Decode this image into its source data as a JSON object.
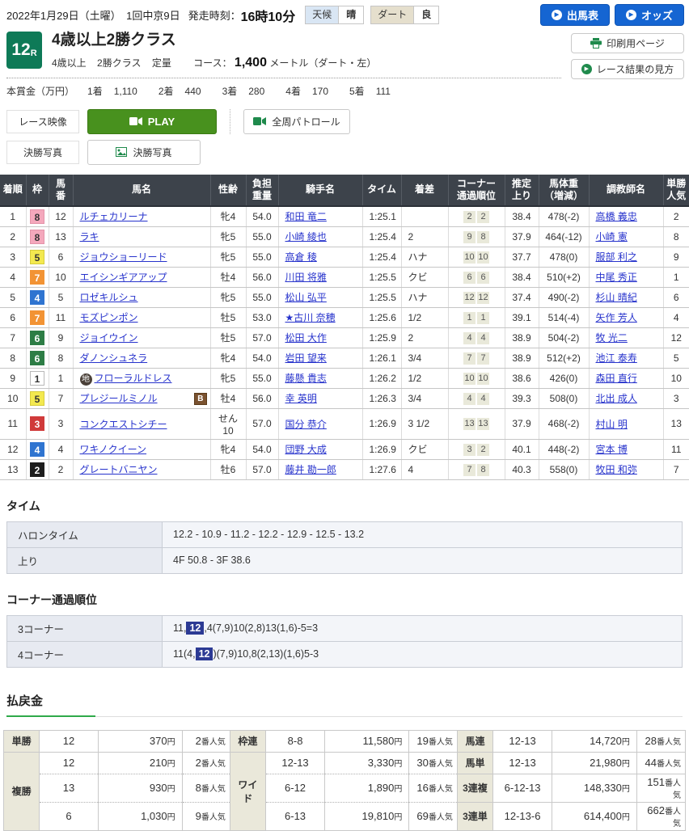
{
  "colors": {
    "link": "#2733cc",
    "table_header_bg": "#3d434b",
    "play_green": "#48911e",
    "blue_button": "#1565d2",
    "race_num_bg": "#0e7a57",
    "highlight_navy": "#2c3a94",
    "payout_accent_green": "#2faa4a",
    "weather_label_bg": "#d9e6f4",
    "track_label_bg": "#e5dfcd",
    "corner_box_bg": "#e9e9da"
  },
  "frame_colors": {
    "1": {
      "bg": "#ffffff",
      "fg": "#333333",
      "bd": "#b8b8b8"
    },
    "2": {
      "bg": "#1d1d1d",
      "fg": "#ffffff",
      "bd": "#1d1d1d"
    },
    "3": {
      "bg": "#d03a3a",
      "fg": "#ffffff",
      "bd": "#d03a3a"
    },
    "4": {
      "bg": "#2f74d0",
      "fg": "#ffffff",
      "bd": "#2f74d0"
    },
    "5": {
      "bg": "#f3e94f",
      "fg": "#333333",
      "bd": "#d6cc3c"
    },
    "6": {
      "bg": "#2d7d45",
      "fg": "#ffffff",
      "bd": "#2d7d45"
    },
    "7": {
      "bg": "#f29334",
      "fg": "#ffffff",
      "bd": "#f29334"
    },
    "8": {
      "bg": "#f4a8bc",
      "fg": "#333333",
      "bd": "#e493a9"
    }
  },
  "header": {
    "date_line": "2022年1月29日（土曜）　1回中京9日",
    "start_label": "発走時刻：",
    "start_time": "16時10分",
    "weather_label": "天候",
    "weather_value": "晴",
    "track_label": "ダート",
    "track_value": "良",
    "btn_entries": "出馬表",
    "btn_odds": "オッズ",
    "btn_print": "印刷用ページ",
    "btn_guide": "レース結果の見方"
  },
  "race": {
    "number": "12",
    "number_suffix": "R",
    "title": "4歳以上2勝クラス",
    "condition_age": "4歳以上",
    "condition_class": "2勝クラス",
    "condition_weight": "定量",
    "course_label": "コース：",
    "course_distance": "1,400",
    "course_unit": "メートル（ダート・左）",
    "prize_label": "本賞金（万円）",
    "prize_items": [
      {
        "place": "1着",
        "amount": "1,110"
      },
      {
        "place": "2着",
        "amount": "440"
      },
      {
        "place": "3着",
        "amount": "280"
      },
      {
        "place": "4着",
        "amount": "170"
      },
      {
        "place": "5着",
        "amount": "111"
      }
    ]
  },
  "media": {
    "video_label": "レース映像",
    "play_button": "PLAY",
    "patrol_button": "全周パトロール",
    "photo_label": "決勝写真",
    "photo_button": "決勝写真"
  },
  "results": {
    "headers": [
      [
        "着順"
      ],
      [
        "枠"
      ],
      [
        "馬",
        "番"
      ],
      [
        "馬名"
      ],
      [
        "性齢"
      ],
      [
        "負担",
        "重量"
      ],
      [
        "騎手名"
      ],
      [
        "タイム"
      ],
      [
        "着差"
      ],
      [
        "コーナー",
        "通過順位"
      ],
      [
        "推定",
        "上り"
      ],
      [
        "馬体重",
        "（増減）"
      ],
      [
        "調教師名"
      ],
      [
        "単勝",
        "人気"
      ]
    ],
    "rows": [
      {
        "pos": "1",
        "frame": "8",
        "num": "12",
        "mark": "",
        "horse": "ルチェカリーナ",
        "blinker": "",
        "sex_age": "牝4",
        "weight": "54.0",
        "jockey": "和田 竜二",
        "time": "1:25.1",
        "margin": "",
        "corners": [
          "2",
          "2"
        ],
        "last3f": "38.4",
        "horse_weight": "478(-2)",
        "trainer": "高橋 義忠",
        "fav": "2"
      },
      {
        "pos": "2",
        "frame": "8",
        "num": "13",
        "mark": "",
        "horse": "ラキ",
        "blinker": "",
        "sex_age": "牝5",
        "weight": "55.0",
        "jockey": "小崎 綾也",
        "time": "1:25.4",
        "margin": "2",
        "corners": [
          "9",
          "8"
        ],
        "last3f": "37.9",
        "horse_weight": "464(-12)",
        "trainer": "小崎 憲",
        "fav": "8"
      },
      {
        "pos": "3",
        "frame": "5",
        "num": "6",
        "mark": "",
        "horse": "ジョウショーリード",
        "blinker": "",
        "sex_age": "牝5",
        "weight": "55.0",
        "jockey": "高倉 稜",
        "time": "1:25.4",
        "margin": "ハナ",
        "corners": [
          "10",
          "10"
        ],
        "last3f": "37.7",
        "horse_weight": "478(0)",
        "trainer": "服部 利之",
        "fav": "9"
      },
      {
        "pos": "4",
        "frame": "7",
        "num": "10",
        "mark": "",
        "horse": "エイシンギアアップ",
        "blinker": "",
        "sex_age": "牡4",
        "weight": "56.0",
        "jockey": "川田 将雅",
        "time": "1:25.5",
        "margin": "クビ",
        "corners": [
          "6",
          "6"
        ],
        "last3f": "38.4",
        "horse_weight": "510(+2)",
        "trainer": "中尾 秀正",
        "fav": "1"
      },
      {
        "pos": "5",
        "frame": "4",
        "num": "5",
        "mark": "",
        "horse": "ロゼキルシュ",
        "blinker": "",
        "sex_age": "牝5",
        "weight": "55.0",
        "jockey": "松山 弘平",
        "time": "1:25.5",
        "margin": "ハナ",
        "corners": [
          "12",
          "12"
        ],
        "last3f": "37.4",
        "horse_weight": "490(-2)",
        "trainer": "杉山 晴紀",
        "fav": "6"
      },
      {
        "pos": "6",
        "frame": "7",
        "num": "11",
        "mark": "",
        "horse": "モズピンポン",
        "blinker": "",
        "sex_age": "牡5",
        "weight": "53.0",
        "jockey": "★古川 奈穂",
        "time": "1:25.6",
        "margin": "1/2",
        "corners": [
          "1",
          "1"
        ],
        "last3f": "39.1",
        "horse_weight": "514(-4)",
        "trainer": "矢作 芳人",
        "fav": "4"
      },
      {
        "pos": "7",
        "frame": "6",
        "num": "9",
        "mark": "",
        "horse": "ジョイウイン",
        "blinker": "",
        "sex_age": "牡5",
        "weight": "57.0",
        "jockey": "松田 大作",
        "time": "1:25.9",
        "margin": "2",
        "corners": [
          "4",
          "4"
        ],
        "last3f": "38.9",
        "horse_weight": "504(-2)",
        "trainer": "牧 光二",
        "fav": "12"
      },
      {
        "pos": "8",
        "frame": "6",
        "num": "8",
        "mark": "",
        "horse": "ダノンシュネラ",
        "blinker": "",
        "sex_age": "牝4",
        "weight": "54.0",
        "jockey": "岩田 望来",
        "time": "1:26.1",
        "margin": "3/4",
        "corners": [
          "7",
          "7"
        ],
        "last3f": "38.9",
        "horse_weight": "512(+2)",
        "trainer": "池江 泰寿",
        "fav": "5"
      },
      {
        "pos": "9",
        "frame": "1",
        "num": "1",
        "mark": "地",
        "horse": "フローラルドレス",
        "blinker": "",
        "sex_age": "牝5",
        "weight": "55.0",
        "jockey": "藤懸 貴志",
        "time": "1:26.2",
        "margin": "1/2",
        "corners": [
          "10",
          "10"
        ],
        "last3f": "38.6",
        "horse_weight": "426(0)",
        "trainer": "森田 直行",
        "fav": "10"
      },
      {
        "pos": "10",
        "frame": "5",
        "num": "7",
        "mark": "",
        "horse": "プレジールミノル",
        "blinker": "B",
        "sex_age": "牡4",
        "weight": "56.0",
        "jockey": "幸 英明",
        "time": "1:26.3",
        "margin": "3/4",
        "corners": [
          "4",
          "4"
        ],
        "last3f": "39.3",
        "horse_weight": "508(0)",
        "trainer": "北出 成人",
        "fav": "3"
      },
      {
        "pos": "11",
        "frame": "3",
        "num": "3",
        "mark": "",
        "horse": "コンクエストシチー",
        "blinker": "",
        "sex_age": "せん10",
        "weight": "57.0",
        "jockey": "国分 恭介",
        "time": "1:26.9",
        "margin": "3 1/2",
        "corners": [
          "13",
          "13"
        ],
        "last3f": "37.9",
        "horse_weight": "468(-2)",
        "trainer": "村山 明",
        "fav": "13"
      },
      {
        "pos": "12",
        "frame": "4",
        "num": "4",
        "mark": "",
        "horse": "ワキノクイーン",
        "blinker": "",
        "sex_age": "牝4",
        "weight": "54.0",
        "jockey": "団野 大成",
        "time": "1:26.9",
        "margin": "クビ",
        "corners": [
          "3",
          "2"
        ],
        "last3f": "40.1",
        "horse_weight": "448(-2)",
        "trainer": "宮本 博",
        "fav": "11"
      },
      {
        "pos": "13",
        "frame": "2",
        "num": "2",
        "mark": "",
        "horse": "グレートバニヤン",
        "blinker": "",
        "sex_age": "牡6",
        "weight": "57.0",
        "jockey": "藤井 勘一郎",
        "time": "1:27.6",
        "margin": "4",
        "corners": [
          "7",
          "8"
        ],
        "last3f": "40.3",
        "horse_weight": "558(0)",
        "trainer": "牧田 和弥",
        "fav": "7"
      }
    ]
  },
  "time_section": {
    "heading": "タイム",
    "rows": [
      {
        "label": "ハロンタイム",
        "value": "12.2 - 10.9 - 11.2 - 12.2 - 12.9 - 12.5 - 13.2"
      },
      {
        "label": "上り",
        "value": "4F 50.8 - 3F 38.6"
      }
    ]
  },
  "corner_section": {
    "heading": "コーナー通過順位",
    "rows": [
      {
        "label": "3コーナー",
        "pre": "11,",
        "hl": "12",
        "post": ",4(7,9)10(2,8)13(1,6)-5=3"
      },
      {
        "label": "4コーナー",
        "pre": "11(4,",
        "hl": "12",
        "post": ")(7,9)10,8(2,13)(1,6)5-3"
      }
    ]
  },
  "payout": {
    "heading": "払戻金",
    "yen_suffix": "円",
    "fav_suffix": "番人気",
    "groups": {
      "tansho": {
        "label": "単勝",
        "rows": [
          {
            "combo": "12",
            "amount": "370",
            "fav": "2"
          }
        ]
      },
      "fukusho": {
        "label": "複勝",
        "rows": [
          {
            "combo": "12",
            "amount": "210",
            "fav": "2"
          },
          {
            "combo": "13",
            "amount": "930",
            "fav": "8"
          },
          {
            "combo": "6",
            "amount": "1,030",
            "fav": "9"
          }
        ]
      },
      "wakuren": {
        "label": "枠連",
        "rows": [
          {
            "combo": "8-8",
            "amount": "11,580",
            "fav": "19"
          }
        ]
      },
      "wide": {
        "label": "ワイド",
        "rows": [
          {
            "combo": "12-13",
            "amount": "3,330",
            "fav": "30"
          },
          {
            "combo": "6-12",
            "amount": "1,890",
            "fav": "16"
          },
          {
            "combo": "6-13",
            "amount": "19,810",
            "fav": "69"
          }
        ]
      },
      "umaren": {
        "label": "馬連",
        "rows": [
          {
            "combo": "12-13",
            "amount": "14,720",
            "fav": "28"
          }
        ]
      },
      "umatan": {
        "label": "馬単",
        "rows": [
          {
            "combo": "12-13",
            "amount": "21,980",
            "fav": "44"
          }
        ]
      },
      "sanrenpuku": {
        "label": "3連複",
        "rows": [
          {
            "combo": "6-12-13",
            "amount": "148,330",
            "fav": "151"
          }
        ]
      },
      "sanrentan": {
        "label": "3連単",
        "rows": [
          {
            "combo": "12-13-6",
            "amount": "614,400",
            "fav": "662"
          }
        ]
      }
    }
  }
}
